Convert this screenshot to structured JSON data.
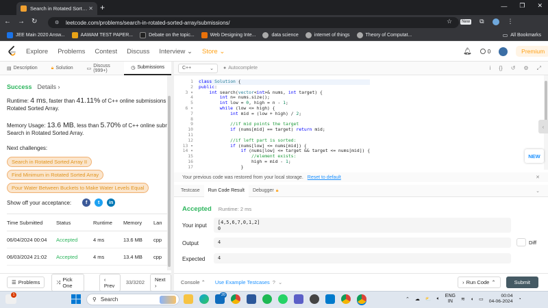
{
  "browser": {
    "tab_title": "Search in Rotated Sorted Array",
    "url": "leetcode.com/problems/search-in-rotated-sorted-array/submissions/",
    "new_tab_glyph": "+",
    "new_label": "New",
    "bookmarks": [
      {
        "label": "JEE Main 2020 Answ...",
        "color": "#1a73e8"
      },
      {
        "label": "AAWAM TEST PAPER...",
        "color": "#e8a317"
      },
      {
        "label": "Debate on the topic...",
        "color": "#333333"
      },
      {
        "label": "Web Designing Inte...",
        "color": "#e8710a"
      },
      {
        "label": "data science",
        "color": "#888888"
      },
      {
        "label": "internet of things",
        "color": "#888888"
      },
      {
        "label": "Theory of Computat...",
        "color": "#888888"
      }
    ],
    "all_bookmarks": "All Bookmarks"
  },
  "header": {
    "nav": [
      "Explore",
      "Problems",
      "Contest",
      "Discuss",
      "Interview ⌄"
    ],
    "store": "Store ⌄",
    "notif_count": "0",
    "premium": "Premium",
    "accent": "#ffa116"
  },
  "left_tabs": {
    "description": "Description",
    "solution": "Solution",
    "discuss": "Discuss (999+)",
    "submissions": "Submissions"
  },
  "submission": {
    "status": "Success",
    "details": "Details ›",
    "runtime_pre": "Runtime: ",
    "runtime_val": "4 ms",
    "runtime_mid": ", faster than ",
    "runtime_pct": "41.11%",
    "runtime_post": " of C++ online submissions for Se",
    "runtime_line2": "Rotated Sorted Array.",
    "memory_pre": "Memory Usage: ",
    "memory_val": "13.6 MB",
    "memory_mid": ", less than ",
    "memory_pct": "5.70%",
    "memory_post": " of C++ online submissio",
    "memory_line2": "Search in Rotated Sorted Array.",
    "next_title": "Next challenges:",
    "challenges": [
      "Search in Rotated Sorted Array II",
      "Find Minimum in Rotated Sorted Array",
      "Pour Water Between Buckets to Make Water Levels Equal"
    ],
    "share_label": "Show off your acceptance:"
  },
  "table": {
    "headers": [
      "Time Submitted",
      "Status",
      "Runtime",
      "Memory",
      "Lan"
    ],
    "rows": [
      [
        "06/04/2024 00:04",
        "Accepted",
        "4 ms",
        "13.6 MB",
        "cpp"
      ],
      [
        "06/03/2024 21:02",
        "Accepted",
        "4 ms",
        "13.4 MB",
        "cpp"
      ]
    ]
  },
  "left_bottom": {
    "problems": "Problems",
    "pick_one": "Pick One",
    "prev": "‹ Prev",
    "page": "33/3202",
    "next": "Next ›"
  },
  "editor": {
    "language": "C++",
    "autocomplete": "Autocomplete",
    "line_numbers": [
      "1",
      "2",
      "3",
      "4",
      "5",
      "6",
      "7",
      "8",
      "9",
      "10",
      "11",
      "12",
      "13",
      "14",
      "15",
      "16",
      "17"
    ],
    "new_badge": "NEW"
  },
  "restore": {
    "message": "Your previous code was restored from your local storage.",
    "link": "Reset to default"
  },
  "console_tabs": {
    "testcase": "Testcase",
    "run_result": "Run Code Result",
    "debugger": "Debugger"
  },
  "result": {
    "status": "Accepted",
    "runtime": "Runtime: 2 ms",
    "input_label": "Your input",
    "input_line1": "[4,5,6,7,0,1,2]",
    "input_line2": "0",
    "output_label": "Output",
    "output": "4",
    "expected_label": "Expected",
    "expected": "4",
    "diff": "Diff"
  },
  "right_bottom": {
    "console": "Console ⌃",
    "use_example": "Use Example Testcases",
    "run": "Run Code",
    "submit": "Submit"
  },
  "taskbar": {
    "search": "Search",
    "notif_badge": "1",
    "lang1": "ENG",
    "lang2": "IN",
    "time": "00:04",
    "date": "04-06-2024",
    "edge_badge": "20"
  }
}
